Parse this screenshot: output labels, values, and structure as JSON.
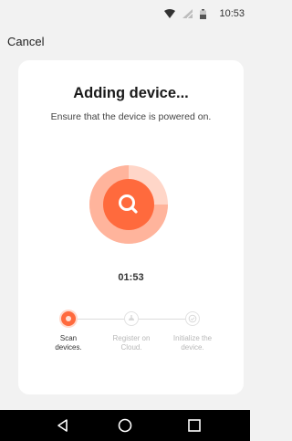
{
  "status_bar": {
    "time": "10:53",
    "icons": [
      "wifi-icon",
      "no-signal-icon",
      "battery-icon"
    ]
  },
  "header": {
    "cancel_label": "Cancel"
  },
  "card": {
    "title": "Adding device...",
    "subtitle": "Ensure that the device is powered on.",
    "timer": "01:53",
    "search_icon": "search-icon",
    "accent_color": "#ff6a3d",
    "steps": [
      {
        "label": "Scan\ndevices.",
        "state": "active"
      },
      {
        "label": "Register on\nCloud.",
        "state": "inactive",
        "icon": "cloud-icon"
      },
      {
        "label": "Initialize the\ndevice.",
        "state": "inactive",
        "icon": "check-icon"
      }
    ]
  },
  "nav_bar": {
    "buttons": [
      "back-icon",
      "home-icon",
      "recents-icon"
    ]
  }
}
